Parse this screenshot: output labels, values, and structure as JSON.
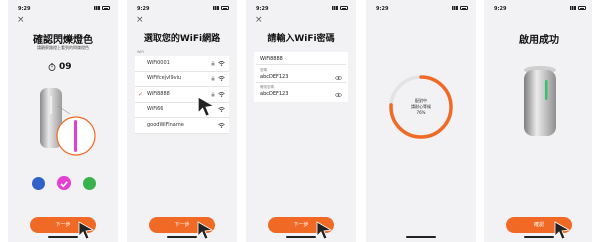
{
  "status": {
    "time": "9:29"
  },
  "screens": [
    {
      "close": "×",
      "title": "確認閃爍燈色",
      "subtitle": "請觀察路燈上看到的閃爍燈色",
      "timer_value": "09",
      "button_label": "下一步"
    },
    {
      "close": "×",
      "title": "選取您的WiFi網路",
      "section_label": "WiFi",
      "networks": [
        {
          "name": "WiFi0001",
          "locked": true,
          "selected": false
        },
        {
          "name": "WiFifcejvl9viu",
          "locked": true,
          "selected": false
        },
        {
          "name": "WiFi8888",
          "locked": true,
          "selected": true
        },
        {
          "name": "WiFi66",
          "locked": false,
          "selected": false
        },
        {
          "name": "goodWiFiname",
          "locked": false,
          "selected": false
        }
      ],
      "button_label": "下一步"
    },
    {
      "close": "×",
      "title": "請輸入WiFi密碼",
      "ssid_value": "WiFi8888",
      "field1_label": "密碼",
      "field1_value": "abcDEF123",
      "field2_label": "確認密碼",
      "field2_value": "abcDEF123",
      "button_label": "下一步"
    },
    {
      "progress_line1": "配對中",
      "progress_line2": "請耐心等候",
      "progress_percent": "76%",
      "progress_fraction": 0.76
    },
    {
      "title": "啟用成功",
      "button_label": "確認"
    }
  ],
  "colors": {
    "accent": "#f06a25",
    "dot_blue": "#2f63c9",
    "dot_magenta": "#e43fd3",
    "dot_green": "#37b24d",
    "check": "#e44b4b"
  }
}
